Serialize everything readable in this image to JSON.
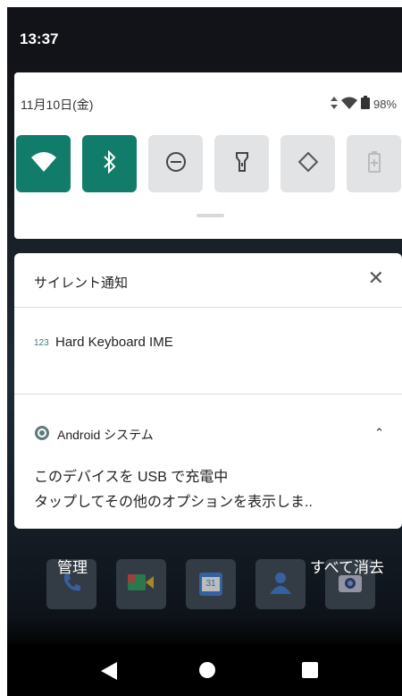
{
  "status_bar": {
    "time": "13:37"
  },
  "quick_settings": {
    "date": "11月10日(金)",
    "battery_percent": "98%",
    "wifi_badge": "4",
    "tiles": [
      {
        "icon": "wifi-icon",
        "active": true
      },
      {
        "icon": "bluetooth-icon",
        "active": true
      },
      {
        "icon": "do-not-disturb-icon",
        "active": false
      },
      {
        "icon": "flashlight-icon",
        "active": false
      },
      {
        "icon": "auto-rotate-icon",
        "active": false
      },
      {
        "icon": "battery-saver-icon",
        "active": false
      }
    ],
    "accent_color": "#127c6a"
  },
  "notifications": {
    "silent_header": "サイレント通知",
    "keyboard": {
      "icon_text": "123",
      "title": "Hard Keyboard IME"
    },
    "android_system": {
      "app_name": "Android システム",
      "line1": "このデバイスを USB で充電中",
      "line2": "タップしてその他のオプションを表示しま.."
    }
  },
  "shade_footer": {
    "manage": "管理",
    "clear_all": "すべて消去"
  },
  "dock_apps": [
    "phone-icon",
    "meet-icon",
    "calendar-icon",
    "contacts-icon",
    "camera-icon"
  ],
  "calendar_day": "31"
}
